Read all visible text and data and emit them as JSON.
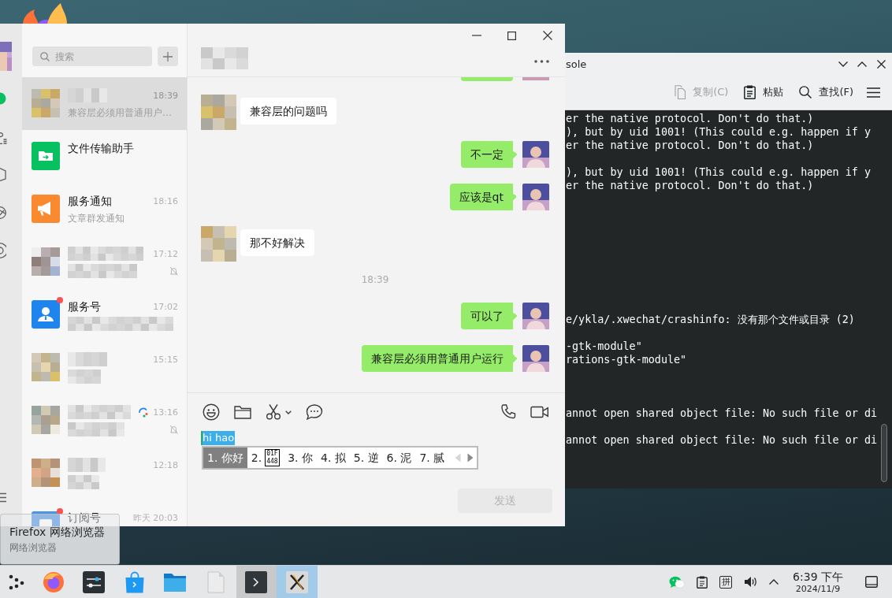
{
  "chat_app": {
    "nav": [
      {
        "kind": "chat",
        "selected": true
      },
      {
        "kind": "person-lines",
        "selected": false
      },
      {
        "kind": "cube",
        "selected": false
      },
      {
        "kind": "aperture",
        "selected": false
      },
      {
        "kind": "ring",
        "selected": false
      },
      {
        "kind": "menu",
        "selected": false
      }
    ],
    "search": {
      "placeholder": "搜索"
    },
    "chats": [
      {
        "kind": "pixelated",
        "name_hidden": true,
        "preview_hidden": false,
        "preview": "兼容层必须用普通用户…",
        "time": "18:39",
        "selected": true,
        "muted": false,
        "unread_dot": false,
        "loop_icon": false
      },
      {
        "kind": "file-transfer",
        "name": "文件传输助手",
        "name_hidden": false,
        "preview_hidden": false,
        "selected": false,
        "muted": false,
        "unread_dot": false,
        "loop_icon": false
      },
      {
        "kind": "notice",
        "name": "服务通知",
        "name_hidden": false,
        "preview_hidden": false,
        "preview": "文章群发通知",
        "time": "18:16",
        "selected": false,
        "muted": false,
        "unread_dot": false,
        "loop_icon": false
      },
      {
        "kind": "pixelated",
        "name_hidden": true,
        "preview_hidden": true,
        "time": "17:12",
        "selected": false,
        "muted": true,
        "unread_dot": false,
        "loop_icon": false
      },
      {
        "kind": "service",
        "name": "服务号",
        "name_hidden": false,
        "preview_hidden": true,
        "time": "17:02",
        "selected": false,
        "muted": false,
        "unread_dot": true,
        "loop_icon": false
      },
      {
        "kind": "pixelated",
        "name_hidden": true,
        "preview_hidden": true,
        "time": "15:15",
        "selected": false,
        "muted": false,
        "unread_dot": false,
        "loop_icon": false
      },
      {
        "kind": "pixelated",
        "name_hidden": true,
        "preview_hidden": true,
        "time": "13:16",
        "selected": false,
        "muted": true,
        "unread_dot": false,
        "loop_icon": true
      },
      {
        "kind": "pixelated",
        "name_hidden": true,
        "preview_hidden": true,
        "time": "12:18",
        "selected": false,
        "muted": false,
        "unread_dot": false,
        "loop_icon": false
      },
      {
        "kind": "subscription",
        "name": "订阅号",
        "name_hidden": false,
        "preview_hidden": false,
        "time": "昨天 20:03",
        "selected": false,
        "muted": false,
        "unread_dot": true,
        "loop_icon": false
      }
    ],
    "conversation": {
      "messages": [
        {
          "kind": "cut-off"
        },
        {
          "kind": "incoming",
          "text": "兼容层的问题吗"
        },
        {
          "kind": "outgoing",
          "text": "不一定"
        },
        {
          "kind": "outgoing",
          "text": "应该是qt"
        },
        {
          "kind": "incoming",
          "text": "那不好解决"
        },
        {
          "kind": "timestamp",
          "text": "18:39"
        },
        {
          "kind": "outgoing",
          "text": "可以了"
        },
        {
          "kind": "outgoing",
          "text": "兼容层必须用普通用户运行"
        }
      ]
    },
    "input": {
      "preedit": "hi hao",
      "candidates": [
        {
          "kind": "text",
          "text": "1. 你好",
          "selected": true
        },
        {
          "kind": "missing-glyph",
          "text": "2.",
          "glyph_code": "01F448",
          "selected": false
        },
        {
          "kind": "text",
          "text": "3. 你",
          "selected": false
        },
        {
          "kind": "text",
          "text": "4. 拟",
          "selected": false
        },
        {
          "kind": "text",
          "text": "5. 逆",
          "selected": false
        },
        {
          "kind": "text",
          "text": "6. 泥",
          "selected": false
        },
        {
          "kind": "text",
          "text": "7. 腻",
          "selected": false
        }
      ],
      "prev_page": {
        "disabled": true
      },
      "next_page": {
        "disabled": false
      },
      "send_button": {
        "label": "发送",
        "disabled": true
      }
    }
  },
  "console": {
    "title": "sole",
    "toolbar": [
      {
        "kind": "copy",
        "label": "复制(C)",
        "disabled": true
      },
      {
        "kind": "paste",
        "label": "粘贴",
        "disabled": false
      },
      {
        "kind": "find",
        "label": "查找(F)",
        "disabled": false
      },
      {
        "kind": "menu",
        "disabled": false
      }
    ],
    "lines": [
      {
        "kind": "text",
        "text": "er the native protocol. Don't do that.)"
      },
      {
        "kind": "text",
        "text": "), but by uid 1001! (This could e.g. happen if y"
      },
      {
        "kind": "text",
        "text": "er the native protocol. Don't do that.)"
      },
      {
        "kind": "blank"
      },
      {
        "kind": "text",
        "text": "), but by uid 1001! (This could e.g. happen if y"
      },
      {
        "kind": "text",
        "text": "er the native protocol. Don't do that.)"
      },
      {
        "kind": "blank"
      },
      {
        "kind": "blank"
      },
      {
        "kind": "blank"
      },
      {
        "kind": "blank"
      },
      {
        "kind": "blank"
      },
      {
        "kind": "blank"
      },
      {
        "kind": "blank"
      },
      {
        "kind": "blank"
      },
      {
        "kind": "blank"
      },
      {
        "kind": "text",
        "text": "e/ykla/.xwechat/crashinfo: 没有那个文件或目录 (2)"
      },
      {
        "kind": "blank"
      },
      {
        "kind": "text",
        "text": "-gtk-module\""
      },
      {
        "kind": "text",
        "text": "rations-gtk-module\""
      },
      {
        "kind": "blank"
      },
      {
        "kind": "blank"
      },
      {
        "kind": "blank"
      },
      {
        "kind": "text",
        "text": "annot open shared object file: No such file or di"
      },
      {
        "kind": "blank"
      },
      {
        "kind": "text",
        "text": "annot open shared object file: No such file or di"
      }
    ]
  },
  "tooltip": {
    "title": "Firefox 网络浏览器",
    "subtitle": "网络浏览器"
  },
  "taskbar": {
    "tasks": [
      {
        "kind": "app-menu",
        "open": false,
        "selected": false
      },
      {
        "kind": "browser",
        "open": false,
        "selected": false
      },
      {
        "kind": "settings",
        "open": false,
        "selected": false
      },
      {
        "kind": "store",
        "open": false,
        "selected": false
      },
      {
        "kind": "files",
        "open": false,
        "selected": false
      },
      {
        "kind": "document",
        "open": false,
        "selected": false
      },
      {
        "kind": "terminal",
        "open": true,
        "selected": false
      },
      {
        "kind": "x-app",
        "open": true,
        "selected": true
      }
    ],
    "tray": {
      "input_method": "拼",
      "time": "6:39 下午",
      "date": "2024/11/9"
    }
  }
}
